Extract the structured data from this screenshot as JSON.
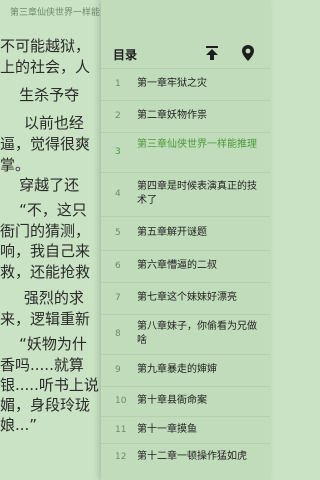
{
  "reader": {
    "chapter_title": "第三章仙侠世界一样能",
    "lines": [
      "不可能越狱，",
      "上的社会，人",
      "    生杀予夺",
      "     以前也经",
      "逼，觉得很爽",
      "掌。",
      "    穿越了还",
      "    “不，这只",
      "衙门的猜测，",
      "响，我自己来",
      "救，还能抢救",
      "     强烈的求",
      "来，逻辑重新",
      "    “妖物为什",
      "香吗.....就算",
      "银.....听书上说",
      "媚，身段玲珑",
      "娘...”"
    ]
  },
  "drawer": {
    "title": "目录",
    "scroll_top_icon": "arrow-up-to-top-icon",
    "locate_icon": "map-pin-icon",
    "active_index": 2,
    "items": [
      {
        "num": "1",
        "label": "第一章牢狱之灾"
      },
      {
        "num": "2",
        "label": "第二章妖物作祟"
      },
      {
        "num": "3",
        "label": "第三章仙侠世界一样能推理"
      },
      {
        "num": "4",
        "label": "第四章是时候表演真正的技术了"
      },
      {
        "num": "5",
        "label": "第五章解开谜题"
      },
      {
        "num": "6",
        "label": "第六章懵逼的二叔"
      },
      {
        "num": "7",
        "label": "第七章这个妹妹好漂亮"
      },
      {
        "num": "8",
        "label": "第八章妹子，你偷看为兄做啥"
      },
      {
        "num": "9",
        "label": "第九章暴走的婶婶"
      },
      {
        "num": "10",
        "label": "第十章县衙命案"
      },
      {
        "num": "11",
        "label": "第十一章摸鱼"
      },
      {
        "num": "12",
        "label": "第十二章一顿操作猛如虎"
      }
    ]
  },
  "colors": {
    "background": "#c9e3c4",
    "drawer": "#c1dcbb",
    "accent": "#4a9a3a"
  }
}
